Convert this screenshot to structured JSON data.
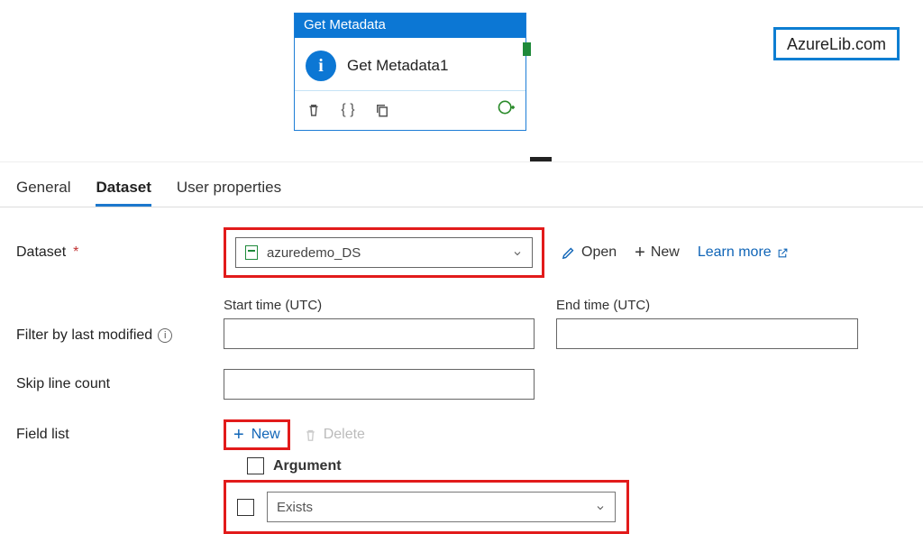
{
  "badge": "AzureLib.com",
  "activity": {
    "type": "Get Metadata",
    "name": "Get Metadata1"
  },
  "tabs": {
    "general": "General",
    "dataset": "Dataset",
    "user_properties": "User properties"
  },
  "labels": {
    "dataset": "Dataset",
    "filter": "Filter by last modified",
    "skip": "Skip line count",
    "field_list": "Field list",
    "start_time": "Start time (UTC)",
    "end_time": "End time (UTC)",
    "argument": "Argument"
  },
  "dataset": {
    "selected": "azuredemo_DS",
    "open": "Open",
    "new": "New",
    "learn_more": "Learn more"
  },
  "field_list": {
    "new": "New",
    "delete": "Delete",
    "row0_value": "Exists"
  }
}
